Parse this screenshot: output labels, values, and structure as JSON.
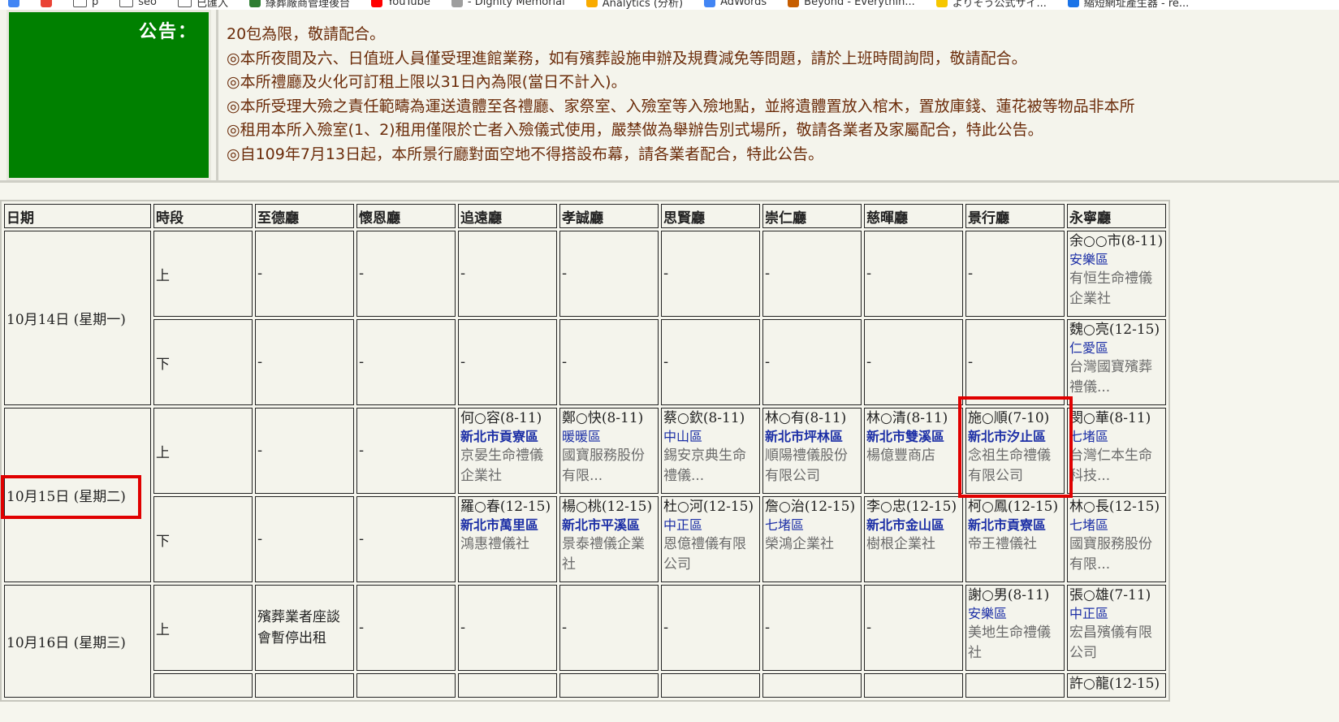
{
  "bookmarks": [
    {
      "label": "",
      "icon": "calendar-icon",
      "color": "#4285f4"
    },
    {
      "label": "",
      "icon": "gmail-icon",
      "color": "#ea4335"
    },
    {
      "label": "p",
      "icon": "folder-icon"
    },
    {
      "label": "seo",
      "icon": "folder-icon"
    },
    {
      "label": "已匯入",
      "icon": "folder-icon"
    },
    {
      "label": "綠葬廠商管理後台",
      "icon": "green-leaf-icon",
      "color": "#2e7d32"
    },
    {
      "label": "YouTube",
      "icon": "youtube-icon",
      "color": "#ff0000"
    },
    {
      "label": "- Dignity Memorial",
      "icon": "dignity-icon",
      "color": "#9e9e9e"
    },
    {
      "label": "Analytics (分析)",
      "icon": "analytics-icon",
      "color": "#f9ab00"
    },
    {
      "label": "AdWords",
      "icon": "google-icon",
      "color": "#4285f4"
    },
    {
      "label": "Beyond - Everythin...",
      "icon": "beyond-icon",
      "color": "#c65d00"
    },
    {
      "label": "よりそう公式サイ...",
      "icon": "yorisou-icon",
      "color": "#f6c700"
    },
    {
      "label": "縮短網址產生器 - re...",
      "icon": "link-icon",
      "color": "#1a73e8"
    }
  ],
  "notice": {
    "label": "公告：",
    "lines": [
      "20包為限，敬請配合。",
      "◎本所夜間及六、日值班人員僅受理進館業務，如有殯葬設施申辦及規費減免等問題，請於上班時間詢問，敬請配合。",
      "◎本所禮廳及火化可訂租上限以31日內為限(當日不計入)。",
      "◎本所受理大殮之責任範疇為運送遺體至各禮廳、家祭室、入殮室等入殮地點，並將遺體置放入棺木，置放庫錢、蓮花被等物品非本所",
      "◎租用本所入殮室(1、2)租用僅限於亡者入殮儀式使用，嚴禁做為舉辦告別式場所，敬請各業者及家屬配合，特此公告。",
      "◎自109年7月13日起，本所景行廳對面空地不得搭設布幕，請各業者配合，特此公告。"
    ]
  },
  "table": {
    "headers": [
      "日期",
      "時段",
      "至德廳",
      "懷恩廳",
      "追遠廳",
      "孝誠廳",
      "思賢廳",
      "崇仁廳",
      "慈暉廳",
      "景行廳",
      "永寧廳"
    ],
    "dates": [
      "10月14日 (星期一)",
      "10月15日 (星期二)",
      "10月16日 (星期三)"
    ],
    "periods": [
      "上",
      "下",
      "上"
    ],
    "rows": [
      [
        "-",
        "-",
        "-",
        "-",
        "-",
        "-",
        "-",
        "-",
        {
          "name": "余○○市(8-11)",
          "district": "安樂區",
          "company": "有恒生命禮儀企業社"
        }
      ],
      [
        "-",
        "-",
        "-",
        "-",
        "-",
        "-",
        "-",
        "-",
        {
          "name": "魏○亮(12-15)",
          "district": "仁愛區",
          "company": "台灣國寶殯葬禮儀..."
        }
      ],
      [
        "-",
        "-",
        {
          "name": "何○容(8-11)",
          "district": "新北市貢寮區",
          "company": "京晏生命禮儀企業社",
          "bold": true
        },
        {
          "name": "鄭○快(8-11)",
          "district": "暖暖區",
          "company": "國寶服務股份有限..."
        },
        {
          "name": "蔡○欽(8-11)",
          "district": "中山區",
          "company": "錫安京典生命禮儀..."
        },
        {
          "name": "林○有(8-11)",
          "district": "新北市坪林區",
          "company": "順陽禮儀股份有限公司",
          "bold": true
        },
        {
          "name": "林○清(8-11)",
          "district": "新北市雙溪區",
          "company": "楊億豐商店",
          "bold": true
        },
        {
          "name": "施○順(7-10)",
          "district": "新北市汐止區",
          "company": "念祖生命禮儀有限公司",
          "bold": true
        },
        {
          "name": "閔○華(8-11)",
          "district": "七堵區",
          "company": "台灣仁本生命科技..."
        }
      ],
      [
        "-",
        "-",
        {
          "name": "羅○春(12-15)",
          "district": "新北市萬里區",
          "company": "鴻惠禮儀社",
          "bold": true
        },
        {
          "name": "楊○桃(12-15)",
          "district": "新北市平溪區",
          "company": "景泰禮儀企業社",
          "bold": true
        },
        {
          "name": "杜○河(12-15)",
          "district": "中正區",
          "company": "恩億禮儀有限公司"
        },
        {
          "name": "詹○治(12-15)",
          "district": "七堵區",
          "company": "榮鴻企業社"
        },
        {
          "name": "李○忠(12-15)",
          "district": "新北市金山區",
          "company": "樹根企業社",
          "bold": true
        },
        {
          "name": "柯○鳳(12-15)",
          "district": "新北市貢寮區",
          "company": "帝王禮儀社",
          "bold": true
        },
        {
          "name": "林○長(12-15)",
          "district": "七堵區",
          "company": "國寶服務股份有限..."
        }
      ],
      [
        {
          "text": "殯葬業者座談會暫停出租"
        },
        "-",
        "-",
        "-",
        "-",
        "-",
        "-",
        {
          "name": "謝○男(8-11)",
          "district": "安樂區",
          "company": "美地生命禮儀社"
        },
        {
          "name": "張○雄(7-11)",
          "district": "中正區",
          "company": "宏昌殯儀有限公司"
        }
      ],
      [
        "",
        "",
        "",
        "",
        "",
        "",
        "",
        "",
        {
          "name": "許○龍(12-15)",
          "district": "",
          "company": ""
        }
      ]
    ]
  },
  "colors": {
    "notice_green": "#008000",
    "notice_text": "#6b2c0a",
    "district_blue": "#1c2fa6",
    "company_gray": "#6b6b6b",
    "highlight_red": "#e00000"
  }
}
